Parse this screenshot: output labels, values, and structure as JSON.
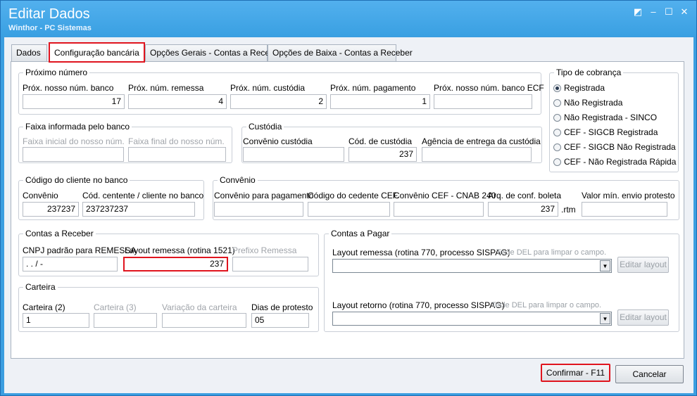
{
  "window": {
    "title": "Editar Dados",
    "subtitle": "Winthor - PC Sistemas"
  },
  "tabs": [
    {
      "label": "Dados"
    },
    {
      "label": "Configuração bancária"
    },
    {
      "label": "Opções Gerais - Contas a Receber"
    },
    {
      "label": "Opções de Baixa - Contas a Receber"
    }
  ],
  "proximo": {
    "title": "Próximo número",
    "fields": [
      {
        "label": "Próx. nosso núm. banco",
        "value": "17"
      },
      {
        "label": "Próx. núm. remessa",
        "value": "4"
      },
      {
        "label": "Próx. núm. custódia",
        "value": "2"
      },
      {
        "label": "Próx. núm. pagamento",
        "value": "1"
      },
      {
        "label": "Próx. nosso núm. banco ECF",
        "value": ""
      }
    ]
  },
  "tipo_cobranca": {
    "title": "Tipo de cobrança",
    "options": [
      {
        "label": "Registrada",
        "selected": true
      },
      {
        "label": "Não Registrada",
        "selected": false
      },
      {
        "label": "Não Registrada - SINCO",
        "selected": false
      },
      {
        "label": "CEF - SIGCB Registrada",
        "selected": false
      },
      {
        "label": "CEF - SIGCB Não Registrada",
        "selected": false
      },
      {
        "label": "CEF - Não Registrada Rápida",
        "selected": false
      }
    ]
  },
  "faixa": {
    "title": "Faixa informada pelo banco",
    "inicial_label": "Faixa inicial do nosso núm.",
    "inicial_value": "",
    "final_label": "Faixa final do nosso núm.",
    "final_value": ""
  },
  "custodia": {
    "title": "Custódia",
    "convenio_label": "Convênio custódia",
    "convenio_value": "",
    "cod_label": "Cód. de custódia",
    "cod_value": "237",
    "agencia_label": "Agência de entrega da custódia",
    "agencia_value": ""
  },
  "codigo_cliente": {
    "title": "Código do cliente no banco",
    "convenio_label": "Convênio",
    "convenio_value": "237237",
    "cedente_label": "Cód. centente / cliente no banco",
    "cedente_value": "237237237"
  },
  "convenio": {
    "title": "Convênio",
    "pagamento_label": "Convênio para pagamento",
    "pagamento_value": "",
    "cedente_label": "Código do cedente CEF.",
    "cedente_value": "",
    "cnab_label": "Convênio CEF - CNAB 240",
    "cnab_value": "",
    "arq_label": "Arq. de conf. boleta",
    "arq_value": "237",
    "arq_ext": ".rtm",
    "valor_label": "Valor mín. envio protesto",
    "valor_value": ""
  },
  "contas_receber": {
    "title": "Contas a Receber",
    "cnpj_label": "CNPJ padrão para REMESSA",
    "cnpj_value": " .  .  /   -",
    "layout_label": "Layout remessa (rotina 1521)",
    "layout_value": "237",
    "prefixo_label": "Prefixo Remessa",
    "prefixo_value": ""
  },
  "carteira": {
    "title": "Carteira",
    "c2_label": "Carteira (2)",
    "c2_value": "1",
    "c3_label": "Carteira (3)",
    "c3_value": "",
    "variacao_label": "Variação da carteira",
    "variacao_value": "",
    "dias_label": "Dias de protesto",
    "dias_value": "05"
  },
  "contas_pagar": {
    "title": "Contas a Pagar",
    "remessa_label": "Layout remessa (rotina 770, processo SISPAG)",
    "retorno_label": "Layout retorno (rotina 770, processo SISPAG)",
    "hint": "Tecle DEL para limpar o campo.",
    "editar_label": "Editar layout"
  },
  "footer": {
    "confirmar": "Confirmar - F11",
    "cancelar": "Cancelar"
  }
}
